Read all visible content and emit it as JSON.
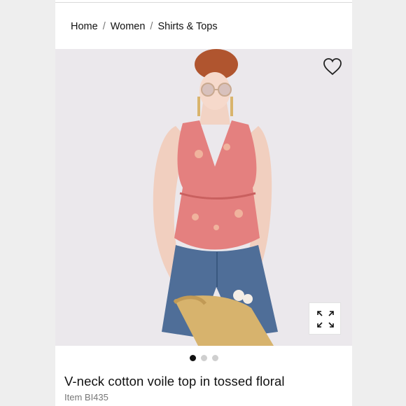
{
  "breadcrumb": {
    "items": [
      "Home",
      "Women",
      "Shirts & Tops"
    ],
    "separator": "/"
  },
  "product": {
    "title": "V-neck cotton voile top in tossed floral",
    "item_number": "Item BI435",
    "image_alt": "Model wearing pink floral V-neck top with denim shorts and straw bag"
  },
  "carousel": {
    "total": 3,
    "active": 0
  },
  "icons": {
    "favorite": "heart-outline-icon",
    "expand": "expand-arrows-icon"
  },
  "colors": {
    "top_pink": "#e4807f",
    "denim": "#4f6e98",
    "background": "#ebe8ec"
  }
}
